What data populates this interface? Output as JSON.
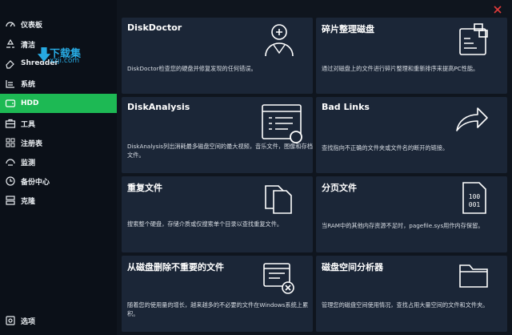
{
  "sidebar": {
    "items": [
      {
        "label": "仪表板",
        "icon": "dashboard-icon"
      },
      {
        "label": "清洁",
        "icon": "recycle-icon"
      },
      {
        "label": "Shredder",
        "icon": "eraser-icon"
      },
      {
        "label": "系统",
        "icon": "system-icon"
      },
      {
        "label": "HDD",
        "icon": "hdd-icon"
      },
      {
        "label": "工具",
        "icon": "toolbox-icon"
      },
      {
        "label": "注册表",
        "icon": "registry-icon"
      },
      {
        "label": "监测",
        "icon": "monitor-icon"
      },
      {
        "label": "备份中心",
        "icon": "backup-icon"
      },
      {
        "label": "克隆",
        "icon": "clone-icon"
      }
    ],
    "settings_label": "选项",
    "active_index": 4
  },
  "watermark": {
    "title": "下载集",
    "sub": "xzji.com"
  },
  "cards": [
    {
      "title": "DiskDoctor",
      "desc": "DiskDoctor检查您的硬盘并修复发现的任何错误。",
      "icon": "doctor-icon"
    },
    {
      "title": "碎片整理磁盘",
      "desc": "通过对磁盘上的文件进行碎片整理和重新排序来提高PC性能。",
      "icon": "defrag-icon"
    },
    {
      "title": "DiskAnalysis",
      "desc": "DiskAnalysis列出消耗最多磁盘空间的最大视频，音乐文件，图像和存档文件。",
      "icon": "analysis-icon"
    },
    {
      "title": "Bad Links",
      "desc": "查找指向不正确的文件夹或文件名的断开的链接。",
      "icon": "share-arrow-icon"
    },
    {
      "title": "重复文件",
      "desc": "搜索整个硬盘，存储介质或仅搜索单个目录以查找重复文件。",
      "icon": "duplicate-files-icon"
    },
    {
      "title": "分页文件",
      "desc": "当RAM中的其他内存资源不足时，pagefile.sys用作内存保留。",
      "icon": "binary-file-icon"
    },
    {
      "title": "从磁盘删除不重要的文件",
      "desc": "随着您的使用量的增长，越来越多的不必要的文件在Windows系统上累积。",
      "icon": "delete-files-icon"
    },
    {
      "title": "磁盘空间分析器",
      "desc": "管理您的磁盘空间使用情况，查找占用大量空间的文件和文件夹。",
      "icon": "folder-icon"
    }
  ],
  "colors": {
    "accent": "#1db954",
    "card": "#1b2637",
    "close": "#e23b3b"
  }
}
